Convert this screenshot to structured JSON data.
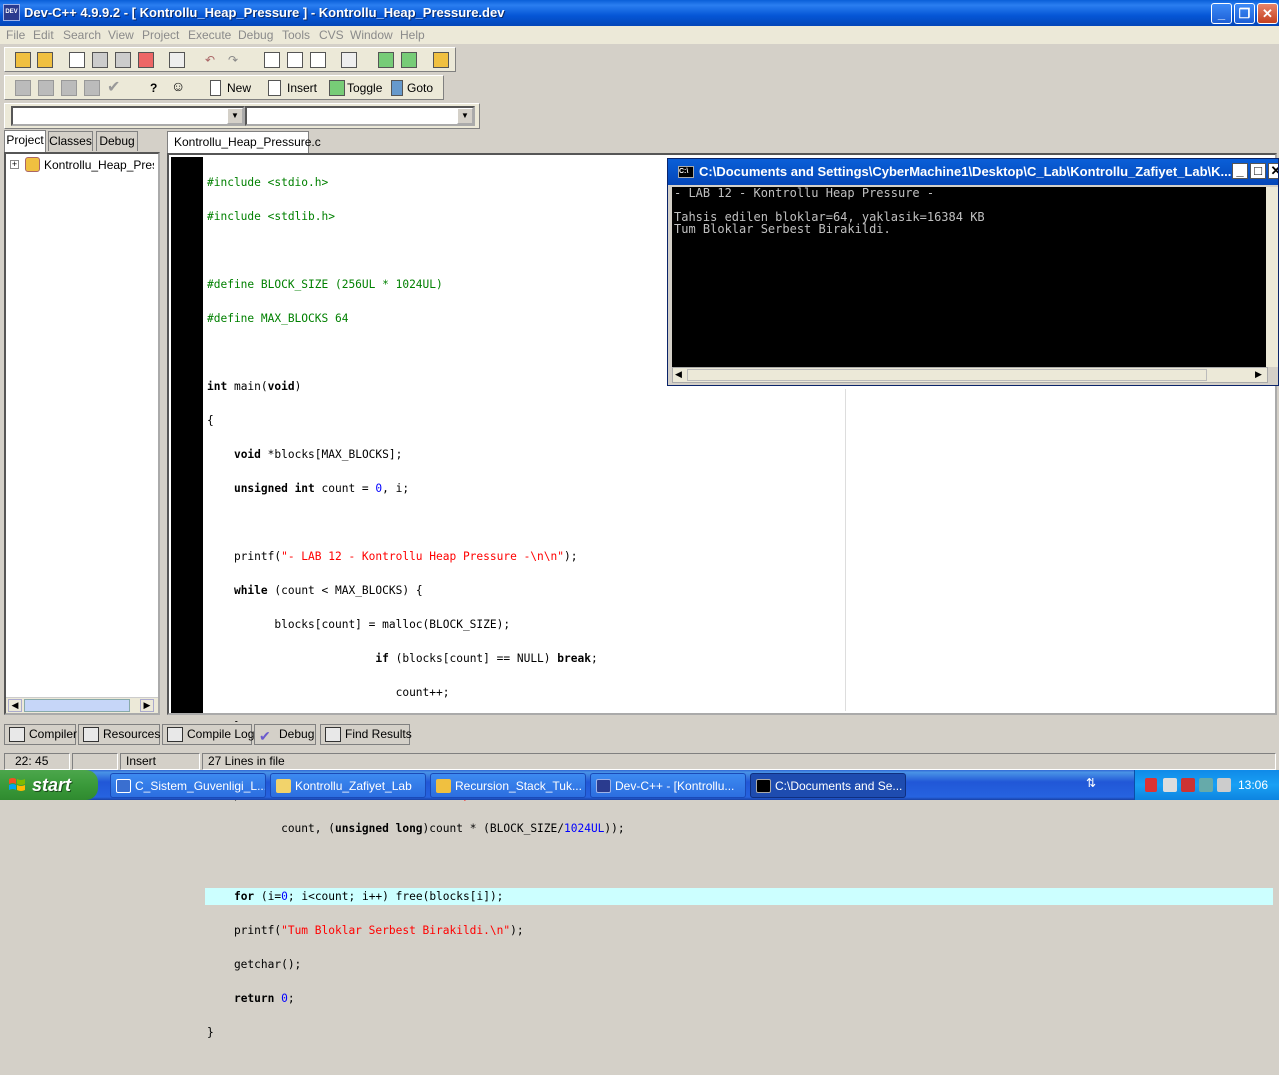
{
  "window": {
    "title": "Dev-C++ 4.9.9.2  -  [ Kontrollu_Heap_Pressure ] - Kontrollu_Heap_Pressure.dev",
    "icon_text": "DEV"
  },
  "menu": [
    "File",
    "Edit",
    "Search",
    "View",
    "Project",
    "Execute",
    "Debug",
    "Tools",
    "CVS",
    "Window",
    "Help"
  ],
  "toolbar2": {
    "new_label": "New",
    "insert_label": "Insert",
    "toggle_label": "Toggle",
    "goto_label": "Goto"
  },
  "left_tabs": [
    "Project",
    "Classes",
    "Debug"
  ],
  "project_tree": {
    "root": "Kontrollu_Heap_Pressure"
  },
  "editor": {
    "tab_label": "Kontrollu_Heap_Pressure.c",
    "highlighted_line": 22
  },
  "console": {
    "title": "C:\\Documents and Settings\\CyberMachine1\\Desktop\\C_Lab\\Kontrollu_Zafiyet_Lab\\K...",
    "output": "- LAB 12 - Kontrollu Heap Pressure -\n\nTahsis edilen bloklar=64, yaklasik=16384 KB\nTum Bloklar Serbest Birakildi."
  },
  "bottom_tabs": [
    "Compiler",
    "Resources",
    "Compile Log",
    "Debug",
    "Find Results"
  ],
  "status": {
    "position": "22: 45",
    "mode": "Insert",
    "lines": "27 Lines in file"
  },
  "taskbar": {
    "start_label": "start",
    "tasks": [
      "C_Sistem_Guvenligi_L...",
      "Kontrollu_Zafiyet_Lab",
      "Recursion_Stack_Tuk...",
      "Dev-C++ - [Kontrollu...",
      "C:\\Documents and Se..."
    ],
    "clock": "13:06"
  },
  "colors": {
    "keyword": "#000000",
    "preprocessor": "#008000",
    "string": "#ff0000",
    "number": "#0000ff",
    "highlight": "#ccffff"
  }
}
